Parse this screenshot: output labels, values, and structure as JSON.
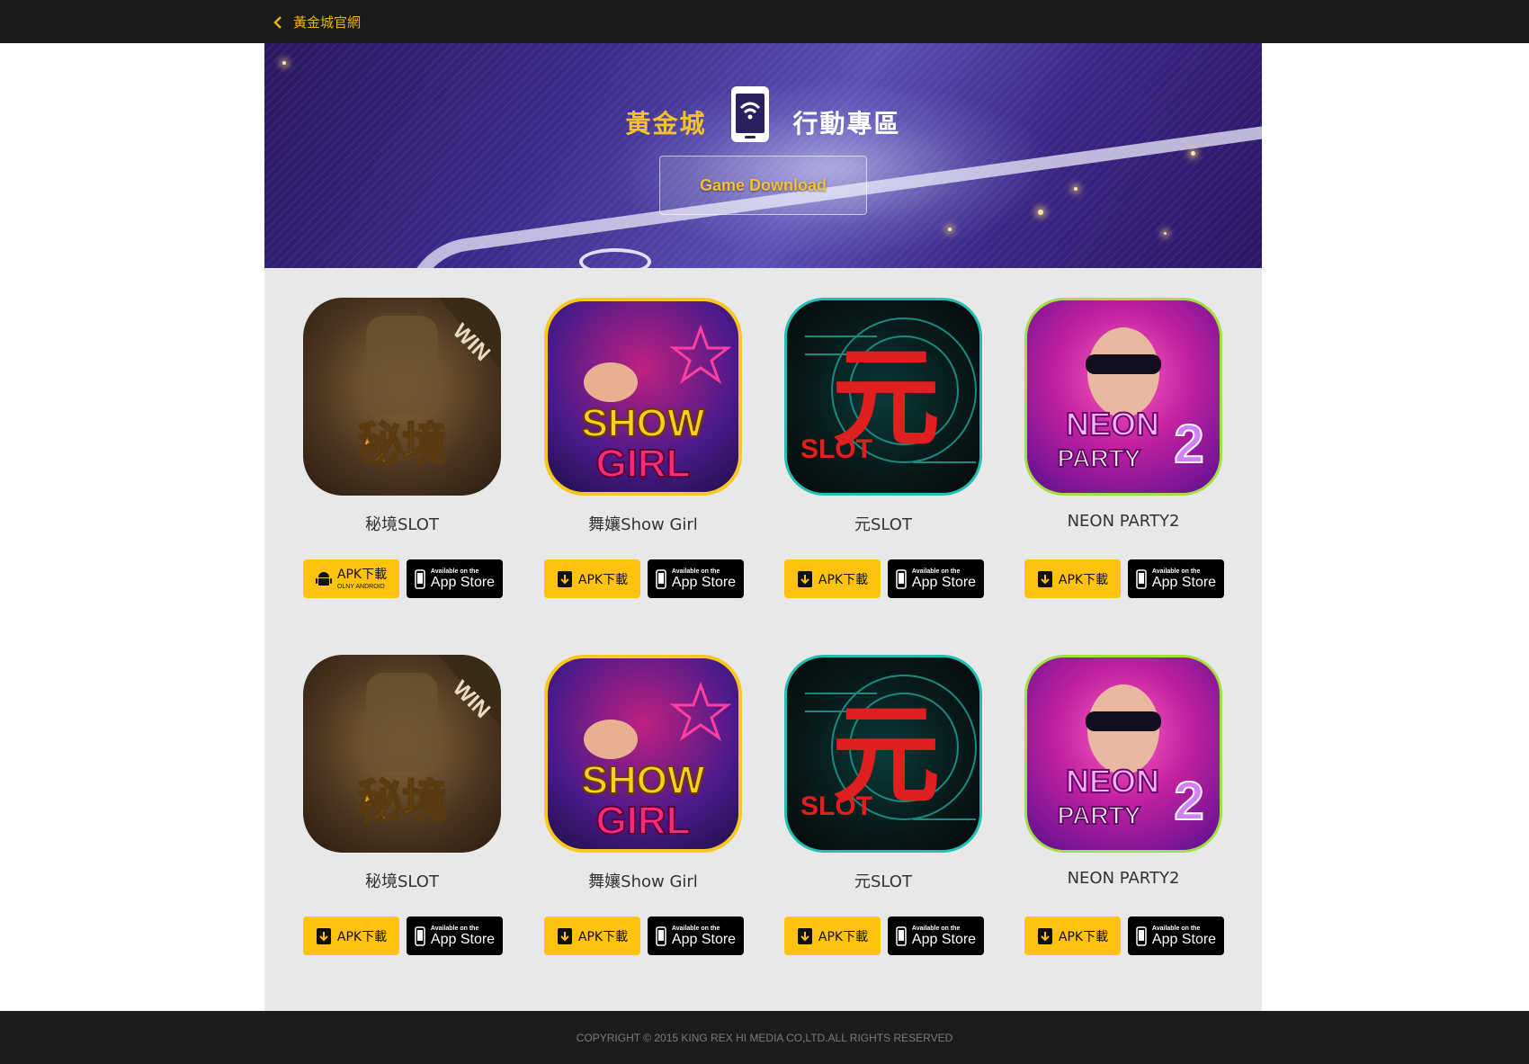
{
  "topbar": {
    "back_label": "黃金城官網"
  },
  "banner": {
    "brand": "黃金城",
    "zone": "行動專區",
    "button_label": "Game Download"
  },
  "apps": [
    {
      "name": "秘境SLOT",
      "icon": "secret-realm-slot-icon",
      "apk_label": "APK下載",
      "apk_sub": "OLNY ANDROID",
      "store_top": "Available on the",
      "store_main": "App Store"
    },
    {
      "name": "舞孃Show Girl",
      "icon": "show-girl-icon",
      "apk_label": "APK下載",
      "store_top": "Available on the",
      "store_main": "App Store"
    },
    {
      "name": "元SLOT",
      "icon": "yuan-slot-icon",
      "apk_label": "APK下載",
      "store_top": "Available on the",
      "store_main": "App Store"
    },
    {
      "name": "NEON PARTY2",
      "icon": "neon-party-2-icon",
      "apk_label": "APK下載",
      "store_top": "Available on the",
      "store_main": "App Store"
    },
    {
      "name": "秘境SLOT",
      "icon": "secret-realm-slot-icon",
      "apk_label": "APK下載",
      "store_top": "Available on the",
      "store_main": "App Store"
    },
    {
      "name": "舞孃Show Girl",
      "icon": "show-girl-icon",
      "apk_label": "APK下載",
      "store_top": "Available on the",
      "store_main": "App Store"
    },
    {
      "name": "元SLOT",
      "icon": "yuan-slot-icon",
      "apk_label": "APK下載",
      "store_top": "Available on the",
      "store_main": "App Store"
    },
    {
      "name": "NEON PARTY2",
      "icon": "neon-party-2-icon",
      "apk_label": "APK下載",
      "store_top": "Available on the",
      "store_main": "App Store"
    }
  ],
  "colors": {
    "topbar": "#1a1a1a",
    "accent_gold": "#ffc20e",
    "footer": "#1c1c1c"
  },
  "footer": {
    "copyright": "COPYRIGHT © 2015 KING REX HI MEDIA CO,LTD.ALL RIGHTS RESERVED"
  }
}
